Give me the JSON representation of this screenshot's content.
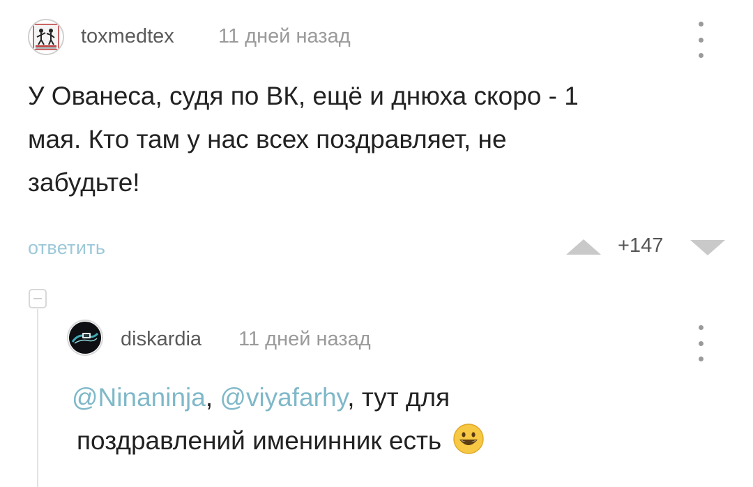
{
  "comments": [
    {
      "username": "toxmedtex",
      "time": "11 дней назад",
      "lines": [
        "У Ованеса, судя по ВК, ещё и днюха скоро - 1",
        "мая. Кто там у нас всех поздравляет, не",
        "забудьте!"
      ],
      "reply_label": "ответить",
      "rating": "+147",
      "icons": [
        "avatar-image",
        "more-vertical-icon",
        "upvote-triangle-icon",
        "downvote-triangle-icon"
      ]
    },
    {
      "username": "diskardia",
      "time": "11 дней назад",
      "mention1": "@Ninaninja",
      "sep": ", ",
      "mention2": "@viyafarhy",
      "line1_rest": ", тут для",
      "line2": "поздравлений именинник есть",
      "icons": [
        "avatar-image",
        "more-vertical-icon",
        "grinning-emoji-icon",
        "collapse-minus-icon"
      ]
    }
  ],
  "colors": {
    "mention": "#7fb8c9",
    "reply_link": "#9cc8d8",
    "muted": "#9a9a9a",
    "thread_line": "#e2e2e2"
  }
}
